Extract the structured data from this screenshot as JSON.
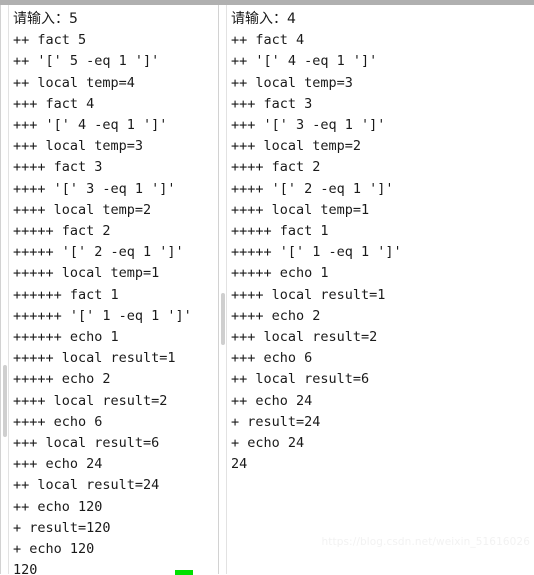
{
  "window": {
    "title": "bash xtrace recursive factorial output",
    "top_strip_color": "#b0b0b0",
    "background_color": "#ffffff",
    "text_color": "#1a1a1a",
    "cursor_color": "#00e000"
  },
  "watermark": {
    "text": "https://blog.csdn.net/weixin_51616026",
    "color": "#f2f2f2"
  },
  "panes": [
    {
      "name": "left-terminal",
      "prompt_label": "请输入：",
      "input_value": "5",
      "final_output": "120",
      "lines": [
        "请输入：5",
        "++ fact 5",
        "++ '[' 5 -eq 1 ']'",
        "++ local temp=4",
        "+++ fact 4",
        "+++ '[' 4 -eq 1 ']'",
        "+++ local temp=3",
        "++++ fact 3",
        "++++ '[' 3 -eq 1 ']'",
        "++++ local temp=2",
        "+++++ fact 2",
        "+++++ '[' 2 -eq 1 ']'",
        "+++++ local temp=1",
        "++++++ fact 1",
        "++++++ '[' 1 -eq 1 ']'",
        "++++++ echo 1",
        "+++++ local result=1",
        "+++++ echo 2",
        "++++ local result=2",
        "++++ echo 6",
        "+++ local result=6",
        "+++ echo 24",
        "++ local result=24",
        "++ echo 120",
        "+ result=120",
        "+ echo 120",
        "120"
      ]
    },
    {
      "name": "right-terminal",
      "prompt_label": "请输入：",
      "input_value": "4",
      "final_output": "24",
      "lines": [
        "请输入：4",
        "++ fact 4",
        "++ '[' 4 -eq 1 ']'",
        "++ local temp=3",
        "+++ fact 3",
        "+++ '[' 3 -eq 1 ']'",
        "+++ local temp=2",
        "++++ fact 2",
        "++++ '[' 2 -eq 1 ']'",
        "++++ local temp=1",
        "+++++ fact 1",
        "+++++ '[' 1 -eq 1 ']'",
        "+++++ echo 1",
        "++++ local result=1",
        "++++ echo 2",
        "+++ local result=2",
        "+++ echo 6",
        "++ local result=6",
        "++ echo 24",
        "+ result=24",
        "+ echo 24",
        "24"
      ]
    }
  ]
}
